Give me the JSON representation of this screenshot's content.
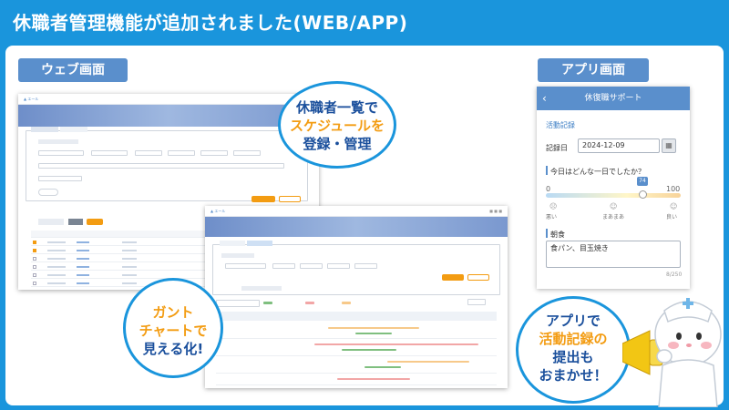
{
  "header": {
    "title": "休職者管理機能が追加されました(WEB/APP)"
  },
  "sections": {
    "web_label": "ウェブ画面",
    "app_label": "アプリ画面"
  },
  "bubbles": {
    "list": {
      "line1": "休職者一覧で",
      "line2": "スケジュールを",
      "line3": "登録・管理"
    },
    "gantt": {
      "line1": "ガント",
      "line2": "チャートで",
      "line3": "見える化!"
    },
    "app": {
      "line1": "アプリで",
      "line2": "活動記録の",
      "line3": "提出も",
      "line4": "おまかせ！"
    }
  },
  "app": {
    "title": "休復職サポート",
    "back_icon": "chevron-left-icon",
    "section_title": "活動記録",
    "date_label": "記録日",
    "date_value": "2024-12-09",
    "question": "今日はどんな一日でしたか？",
    "slider": {
      "min": "0",
      "max": "100",
      "value": "74"
    },
    "faces": [
      "悪い",
      "まあまあ",
      "良い"
    ],
    "meal_title": "朝食",
    "meal_value": "食パン、目玉焼き",
    "char_count": "8/250"
  },
  "colors": {
    "header_blue": "#1a95dc",
    "section_blue": "#5a8fcc",
    "accent_orange": "#f39c12",
    "title_navy": "#1a4f9c"
  }
}
